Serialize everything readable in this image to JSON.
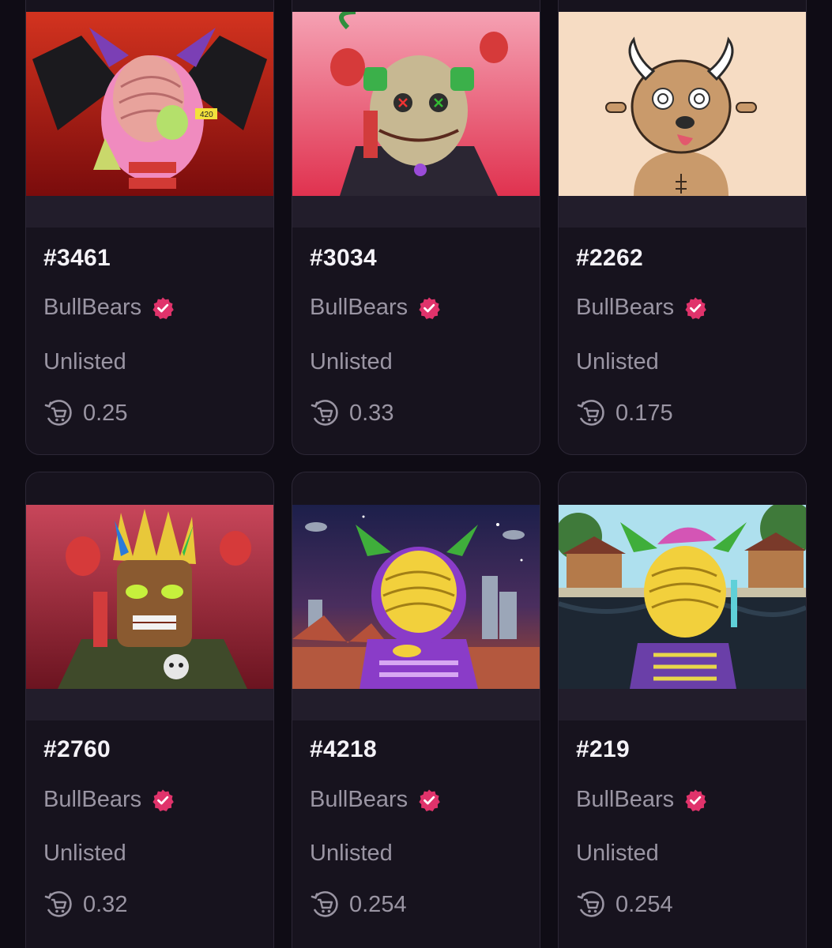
{
  "colors": {
    "background": "#0f0c15",
    "card": "#17131e",
    "card_border": "#2c2736",
    "verified_badge": "#e0336b",
    "muted_text": "#9a95a3",
    "title_text": "#f4f2f7"
  },
  "cards": [
    {
      "token_id": "#3461",
      "collection": "BullBears",
      "status": "Unlisted",
      "price": "0.25",
      "art_tag": "420",
      "icons": [
        "verified-badge-icon",
        "cart-refresh-icon"
      ]
    },
    {
      "token_id": "#3034",
      "collection": "BullBears",
      "status": "Unlisted",
      "price": "0.33",
      "icons": [
        "verified-badge-icon",
        "cart-refresh-icon"
      ]
    },
    {
      "token_id": "#2262",
      "collection": "BullBears",
      "status": "Unlisted",
      "price": "0.175",
      "icons": [
        "verified-badge-icon",
        "cart-refresh-icon"
      ]
    },
    {
      "token_id": "#2760",
      "collection": "BullBears",
      "status": "Unlisted",
      "price": "0.32",
      "icons": [
        "verified-badge-icon",
        "cart-refresh-icon"
      ]
    },
    {
      "token_id": "#4218",
      "collection": "BullBears",
      "status": "Unlisted",
      "price": "0.254",
      "icons": [
        "verified-badge-icon",
        "cart-refresh-icon"
      ]
    },
    {
      "token_id": "#219",
      "collection": "BullBears",
      "status": "Unlisted",
      "price": "0.254",
      "icons": [
        "verified-badge-icon",
        "cart-refresh-icon"
      ]
    }
  ]
}
